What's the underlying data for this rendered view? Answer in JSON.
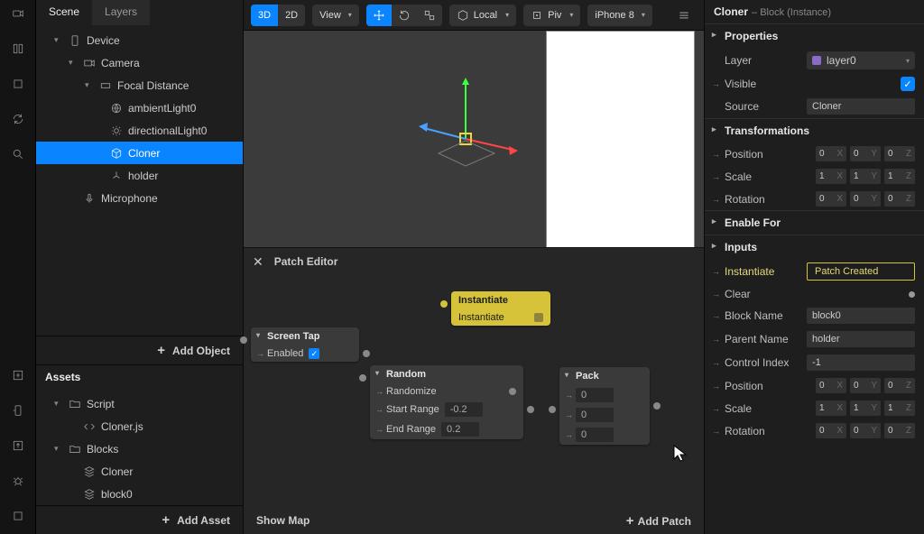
{
  "scene": {
    "tabs": [
      "Scene",
      "Layers"
    ],
    "tree": [
      {
        "label": "Device",
        "depth": 1,
        "icon": "device"
      },
      {
        "label": "Camera",
        "depth": 2,
        "icon": "camera"
      },
      {
        "label": "Focal Distance",
        "depth": 3,
        "icon": "focal"
      },
      {
        "label": "ambientLight0",
        "depth": 4,
        "icon": "globe"
      },
      {
        "label": "directionalLight0",
        "depth": 4,
        "icon": "sun"
      },
      {
        "label": "Cloner",
        "depth": 4,
        "icon": "cube",
        "selected": true
      },
      {
        "label": "holder",
        "depth": 4,
        "icon": "axes"
      },
      {
        "label": "Microphone",
        "depth": 2,
        "icon": "mic"
      }
    ],
    "add_object": "Add Object"
  },
  "assets": {
    "title": "Assets",
    "tree": [
      {
        "label": "Script",
        "depth": 1,
        "icon": "folder"
      },
      {
        "label": "Cloner.js",
        "depth": 2,
        "icon": "code"
      },
      {
        "label": "Blocks",
        "depth": 1,
        "icon": "folder"
      },
      {
        "label": "Cloner",
        "depth": 2,
        "icon": "stack"
      },
      {
        "label": "block0",
        "depth": 2,
        "icon": "stack"
      }
    ],
    "add_asset": "Add Asset"
  },
  "toolbar": {
    "view3d": "3D",
    "view2d": "2D",
    "view": "View",
    "local": "Local",
    "pivot": "Piv",
    "device": "iPhone 8"
  },
  "patchEditor": {
    "title": "Patch Editor",
    "showMap": "Show Map",
    "addPatch": "Add Patch",
    "nodes": {
      "screenTap": {
        "title": "Screen Tap",
        "rows": [
          {
            "label": "Enabled",
            "checked": true
          }
        ]
      },
      "instantiate": {
        "title": "Instantiate",
        "rows": [
          {
            "label": "Instantiate"
          }
        ]
      },
      "random": {
        "title": "Random",
        "rows": [
          {
            "label": "Randomize"
          },
          {
            "label": "Start Range",
            "val": "-0.2"
          },
          {
            "label": "End Range",
            "val": "0.2"
          }
        ]
      },
      "pack": {
        "title": "Pack",
        "rows": [
          {
            "val": "0"
          },
          {
            "val": "0"
          },
          {
            "val": "0"
          }
        ]
      }
    }
  },
  "inspector": {
    "title": "Cloner",
    "subtitle": "– Block (Instance)",
    "sections": {
      "properties": "Properties",
      "transformations": "Transformations",
      "enableFor": "Enable For",
      "inputs": "Inputs"
    },
    "props": {
      "layerLbl": "Layer",
      "layerVal": "layer0",
      "visibleLbl": "Visible",
      "sourceLbl": "Source",
      "sourceVal": "Cloner",
      "positionLbl": "Position",
      "position": [
        "0",
        "0",
        "0"
      ],
      "scaleLbl": "Scale",
      "scale": [
        "1",
        "1",
        "1"
      ],
      "rotationLbl": "Rotation",
      "rotation": [
        "0",
        "0",
        "0"
      ],
      "instantiateLbl": "Instantiate",
      "instantiateBtn": "Patch Created",
      "clearLbl": "Clear",
      "blockNameLbl": "Block Name",
      "blockNameVal": "block0",
      "parentNameLbl": "Parent Name",
      "parentNameVal": "holder",
      "controlIndexLbl": "Control Index",
      "controlIndexVal": "-1",
      "position2": [
        "0",
        "0",
        "0"
      ],
      "scale2": [
        "1",
        "1",
        "1"
      ],
      "rotation2": [
        "0",
        "0",
        "0"
      ]
    }
  }
}
